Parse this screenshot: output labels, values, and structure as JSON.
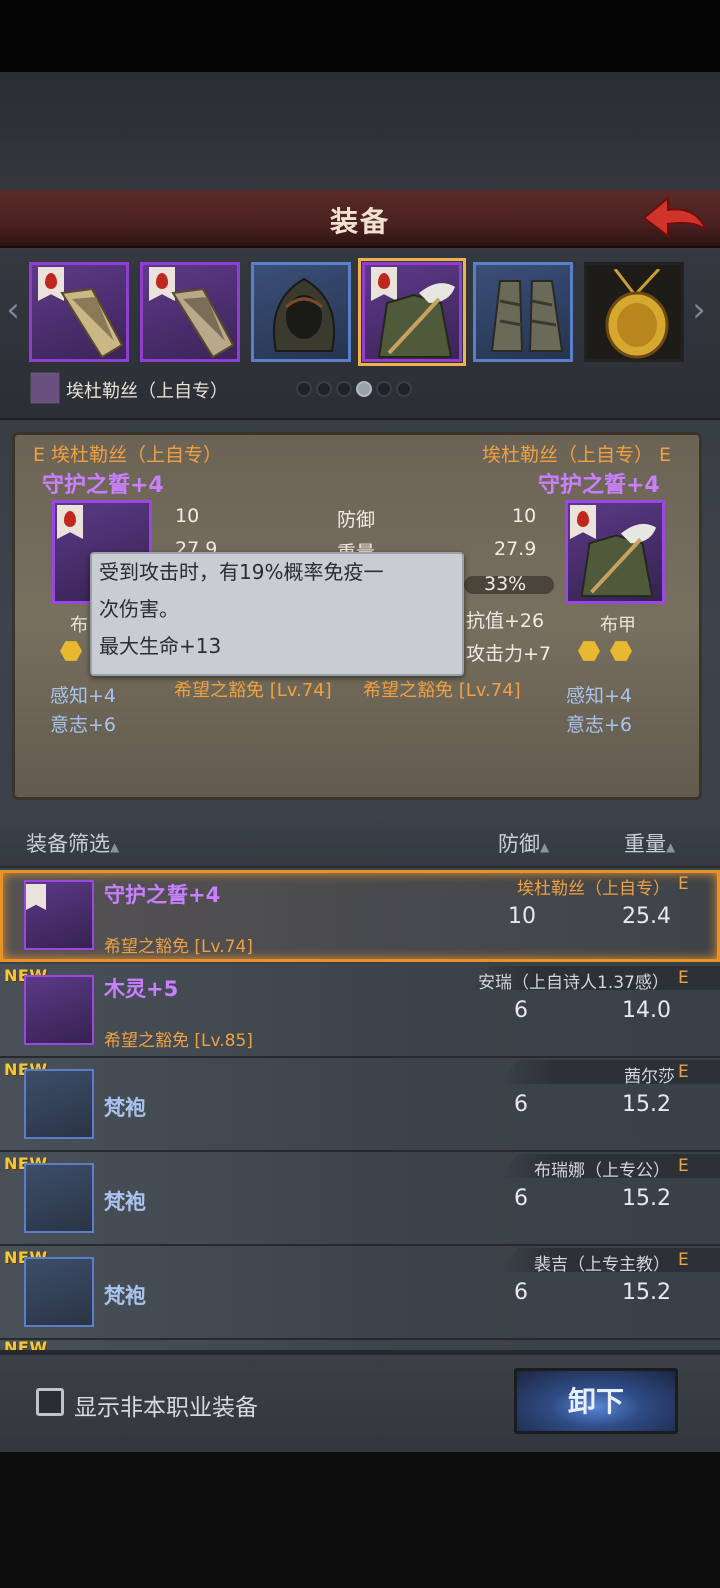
{
  "header": {
    "title": "装备"
  },
  "character": {
    "name": "埃杜勒丝（上自专）"
  },
  "compare": {
    "left_owner": "E 埃杜勒丝（上自专）",
    "right_owner": "埃杜勒丝（上自专） E",
    "left_item_name": "守护之誓+4",
    "right_item_name": "守护之誓+4",
    "rows": [
      {
        "left": "10",
        "label": "防御",
        "right": "10"
      },
      {
        "left": "27.9",
        "label": "重量",
        "right": "27.9"
      },
      {
        "left": "",
        "label": "",
        "right": "33%"
      }
    ],
    "right_extra1": "抗值+26",
    "right_extra2": "攻击力+7",
    "left_item_type": "布",
    "right_item_type": "布甲",
    "left_stat1": "感知+4",
    "left_stat2": "意志+6",
    "right_stat1": "感知+4",
    "right_stat2": "意志+6",
    "left_enchant": "希望之豁免 [Lv.74]",
    "right_enchant": "希望之豁免 [Lv.74]"
  },
  "tooltip": {
    "line1": "受到攻击时，有19%概率免疫一",
    "line2": "次伤害。",
    "line3": "最大生命+13"
  },
  "filter": {
    "label": "装备筛选",
    "col_defense": "防御",
    "col_weight": "重量"
  },
  "items": [
    {
      "name": "守护之誓+4",
      "owner": "埃杜勒丝（上自专）",
      "e": "E",
      "defense": "10",
      "weight": "25.4",
      "sub": "希望之豁免 [Lv.74]",
      "new": ""
    },
    {
      "name": "木灵+5",
      "owner": "安瑞（上自诗人1.37感）",
      "e": "E",
      "defense": "6",
      "weight": "14.0",
      "sub": "希望之豁免 [Lv.85]",
      "new": "NEW"
    },
    {
      "name": "梵袍",
      "owner": "茜尔莎",
      "e": "E",
      "defense": "6",
      "weight": "15.2",
      "sub": "",
      "new": "NEW"
    },
    {
      "name": "梵袍",
      "owner": "布瑞娜（上专公）",
      "e": "E",
      "defense": "6",
      "weight": "15.2",
      "sub": "",
      "new": "NEW"
    },
    {
      "name": "梵袍",
      "owner": "裴吉（上专主教）",
      "e": "E",
      "defense": "6",
      "weight": "15.2",
      "sub": "",
      "new": "NEW"
    },
    {
      "name": "",
      "owner": "",
      "e": "",
      "defense": "",
      "weight": "",
      "sub": "",
      "new": "NEW"
    }
  ],
  "footer": {
    "show_other_label": "显示非本职业装备",
    "unequip_label": "卸下"
  },
  "colors": {
    "accent_orange": "#f0a040",
    "rare_purple": "#c980ff",
    "header_red": "#5a2a28"
  },
  "pager": {
    "count": 6,
    "active": 4
  }
}
